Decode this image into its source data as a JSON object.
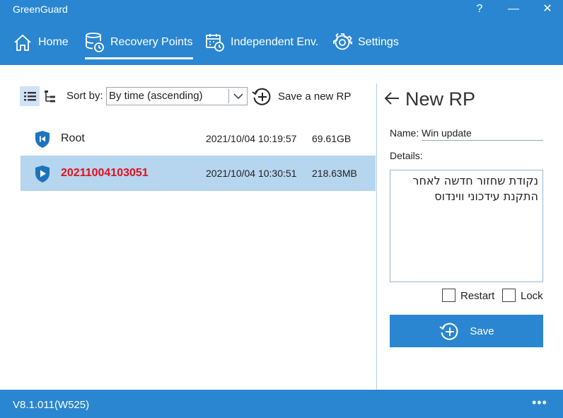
{
  "window": {
    "title": "GreenGuard",
    "help_label": "?",
    "minimize_label": "—",
    "close_label": "✕"
  },
  "nav": {
    "items": [
      {
        "label": "Home",
        "icon": "home-icon"
      },
      {
        "label": "Recovery Points",
        "icon": "database-restore-icon",
        "active": true
      },
      {
        "label": "Independent Env.",
        "icon": "calendar-clock-icon"
      },
      {
        "label": "Settings",
        "icon": "gear-icon"
      }
    ]
  },
  "toolbar": {
    "sort_label": "Sort by:",
    "sort_value": "By time (ascending)",
    "save_new_label": "Save a new RP"
  },
  "recovery_points": [
    {
      "name": "Root",
      "time": "2021/10/04  10:19:57",
      "size": "69.61GB",
      "selected": false
    },
    {
      "name": "20211004103051",
      "time": "2021/10/04  10:30:51",
      "size": "218.63MB",
      "selected": true
    }
  ],
  "panel": {
    "title": "New RP",
    "name_label": "Name:",
    "name_value": "Win update",
    "details_label": "Details:",
    "details_value": "נקודת שחזור חדשה לאחר התקנת עידכוני ווינדוס",
    "restart_label": "Restart",
    "lock_label": "Lock",
    "save_label": "Save"
  },
  "status": {
    "version": "V8.1.011(W525)",
    "more_label": "•••"
  },
  "colors": {
    "accent": "#2a86d0",
    "selected_row": "#b6d5ef",
    "highlight_text": "#e0101a",
    "shield": "#1e73be"
  }
}
